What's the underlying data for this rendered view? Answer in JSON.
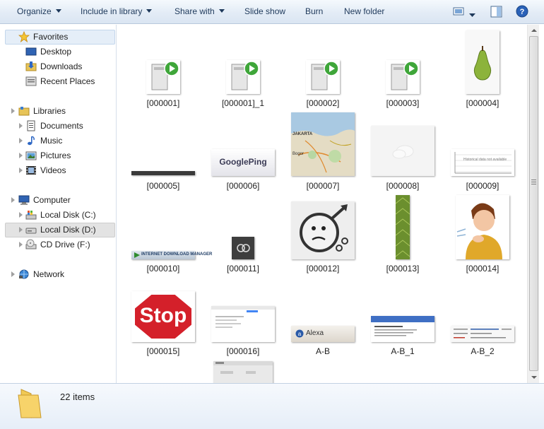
{
  "toolbar": {
    "organize": "Organize",
    "include_in_library": "Include in library",
    "share_with": "Share with",
    "slide_show": "Slide show",
    "burn": "Burn",
    "new_folder": "New folder"
  },
  "nav": {
    "favorites": "Favorites",
    "desktop": "Desktop",
    "downloads": "Downloads",
    "recent_places": "Recent Places",
    "libraries": "Libraries",
    "documents": "Documents",
    "music": "Music",
    "pictures": "Pictures",
    "videos": "Videos",
    "computer": "Computer",
    "local_disk_c": "Local Disk (C:)",
    "local_disk_d": "Local Disk (D:)",
    "cd_drive_f": "CD Drive (F:)",
    "network": "Network"
  },
  "files": [
    "[000001]",
    "[000001]_1",
    "[000002]",
    "[000003]",
    "[000004]",
    "[000005]",
    "[000006]",
    "[000007]",
    "[000008]",
    "[000009]",
    "[000010]",
    "[000011]",
    "[000012]",
    "[000013]",
    "[000014]",
    "[000015]",
    "[000016]",
    "A-B",
    "A-B_1",
    "A-B_2"
  ],
  "thumb_text": {
    "googleping": "GooglePing",
    "idm": "INTERNET DOWNLOAD MANAGER",
    "stop": "Stop",
    "alexa": "Alexa",
    "jakarta": "JAKARTA",
    "bogor": "Bogor",
    "chart_msg": "Historical data not available"
  },
  "status": {
    "item_count": "22 items"
  },
  "colors": {
    "toolbar_text": "#1e395b",
    "selection": "#e5eef8"
  }
}
